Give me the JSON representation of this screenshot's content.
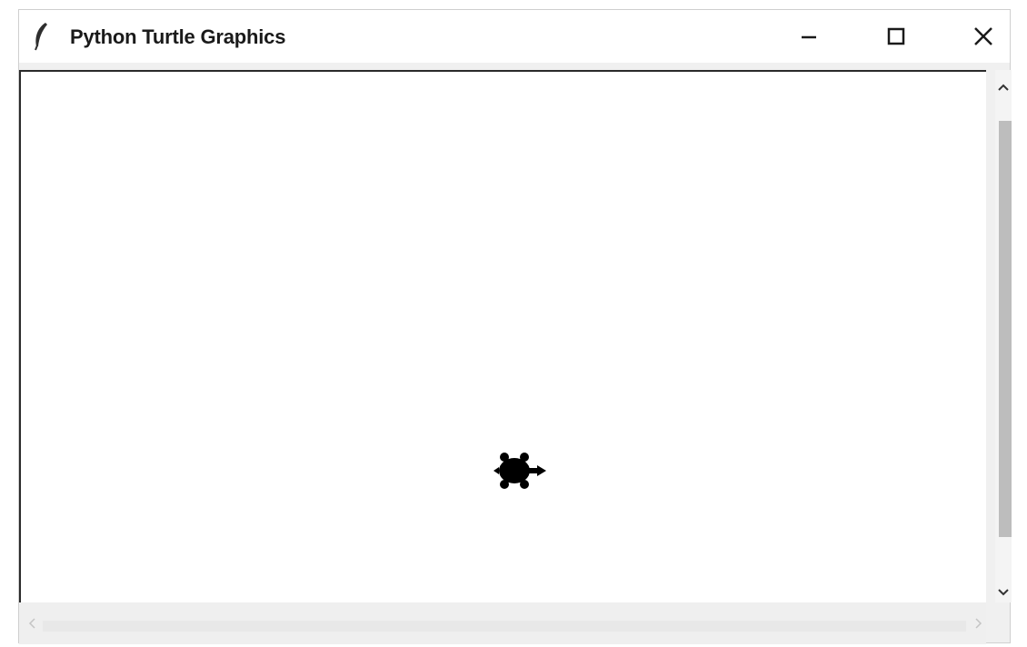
{
  "window": {
    "title": "Python Turtle Graphics",
    "icon": "feather-icon",
    "controls": {
      "minimize_icon": "minimize-icon",
      "maximize_icon": "maximize-icon",
      "close_icon": "close-icon"
    }
  },
  "canvas": {
    "background": "#ffffff",
    "turtle_color": "#000000",
    "turtle_heading": "east",
    "turtle_icon": "turtle-icon"
  },
  "scrollbars": {
    "vertical": {
      "up_icon": "chevron-up-icon",
      "down_icon": "chevron-down-icon",
      "thumb_color": "#bdbdbd"
    },
    "horizontal": {
      "left_icon": "chevron-left-icon",
      "right_icon": "chevron-right-icon"
    }
  }
}
